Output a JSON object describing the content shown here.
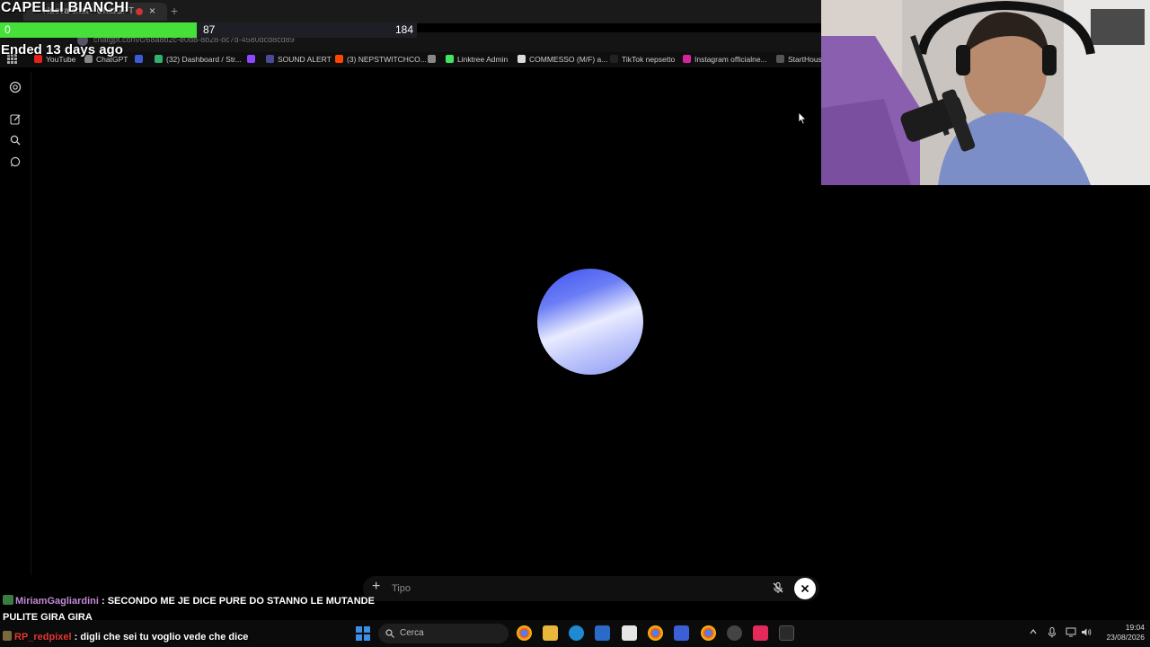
{
  "overlay": {
    "stream_title": "CAPELLI BIANCHI",
    "progress": {
      "min": "0",
      "current": "87",
      "max": "184",
      "fraction": 0.473
    },
    "ended_text": "Ended 13 days ago"
  },
  "browser": {
    "tab_title": "Nuova chat - ChatGPT",
    "new_tab_label": "+",
    "close_tab_label": "×",
    "url": "chatgpt.com/c/68a8b2c-e0d8-8b28-bc7d-4580dcd8cd89",
    "bookmarks": [
      {
        "label": "YouTube",
        "color": "#e62117"
      },
      {
        "label": "ChatGPT",
        "color": "#888888"
      },
      {
        "label": "",
        "color": "#3b5bdb"
      },
      {
        "label": "(32) Dashboard / Str...",
        "color": "#2fb36b"
      },
      {
        "label": "",
        "color": "#9146ff"
      },
      {
        "label": "SOUND ALERT",
        "color": "#4a4a9a"
      },
      {
        "label": "(3) NEPSTWITCHCO...",
        "color": "#ff4500"
      },
      {
        "label": "",
        "color": "#888888"
      },
      {
        "label": "Linktree Admin",
        "color": "#43e55e"
      },
      {
        "label": "COMMESSO (M/F) a...",
        "color": "#dddddd"
      },
      {
        "label": "TikTok nepsetto",
        "color": "#222222"
      },
      {
        "label": "Instagram officialne...",
        "color": "#d6249f"
      },
      {
        "label": "StartHouse",
        "color": "#555555"
      }
    ]
  },
  "composer": {
    "placeholder": "Tipo",
    "plus_label": "+"
  },
  "chat": [
    {
      "user": "MiriamGagliardini",
      "separator": " : ",
      "message": "SECONDO ME JE DICE PURE DO STANNO LE MUTANDE",
      "message_cont": "PULITE GIRA GIRA"
    },
    {
      "user": "RP_redpixel",
      "separator": " : ",
      "message": "digli che sei tu voglio vede che dice"
    }
  ],
  "taskbar": {
    "search_label": "Cerca",
    "time": "19:04",
    "date": "23/08/2026"
  },
  "colors": {
    "progress_fill": "#46e03a",
    "orb_primary": "#3f52f0",
    "orb_highlight": "#e9ecff"
  }
}
